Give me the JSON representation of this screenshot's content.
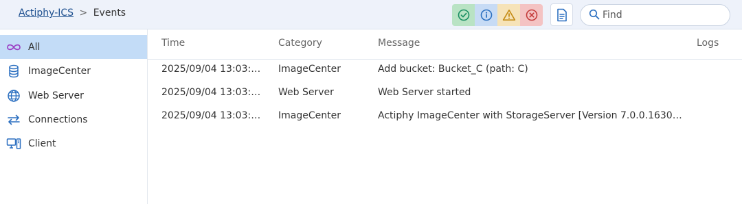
{
  "breadcrumb": {
    "root": "Actiphy-ICS",
    "separator": ">",
    "current": "Events"
  },
  "filters": [
    {
      "name": "success",
      "icon": "check-circle-icon",
      "color": "#1a8f63"
    },
    {
      "name": "information",
      "icon": "info-circle-icon",
      "color": "#2b6fc0"
    },
    {
      "name": "warning",
      "icon": "warning-triangle-icon",
      "color": "#c48b14"
    },
    {
      "name": "error",
      "icon": "error-circle-icon",
      "color": "#c43a3a"
    }
  ],
  "toolbar": {
    "log_icon": "document-icon"
  },
  "search": {
    "placeholder": "Find",
    "value": ""
  },
  "sidebar": {
    "items": [
      {
        "label": "All",
        "icon": "infinity-icon",
        "active": true
      },
      {
        "label": "ImageCenter",
        "icon": "database-icon",
        "active": false
      },
      {
        "label": "Web Server",
        "icon": "globe-icon",
        "active": false
      },
      {
        "label": "Connections",
        "icon": "arrows-exchange-icon",
        "active": false
      },
      {
        "label": "Client",
        "icon": "computer-icon",
        "active": false
      }
    ]
  },
  "table": {
    "columns": {
      "time": "Time",
      "category": "Category",
      "message": "Message",
      "logs": "Logs"
    },
    "rows": [
      {
        "time": "2025/09/04 13:03:…",
        "category": "ImageCenter",
        "message": "Add bucket: Bucket_C (path: C)",
        "logs": ""
      },
      {
        "time": "2025/09/04 13:03:…",
        "category": "Web Server",
        "message": "Web Server started",
        "logs": ""
      },
      {
        "time": "2025/09/04 13:03:…",
        "category": "ImageCenter",
        "message": "Actiphy ImageCenter with StorageServer [Version 7.0.0.1630]…",
        "logs": ""
      }
    ]
  },
  "colors": {
    "accent": "#2b6fc0",
    "active_bg": "#c3dcf7",
    "topbar_bg": "#eef2fa"
  }
}
